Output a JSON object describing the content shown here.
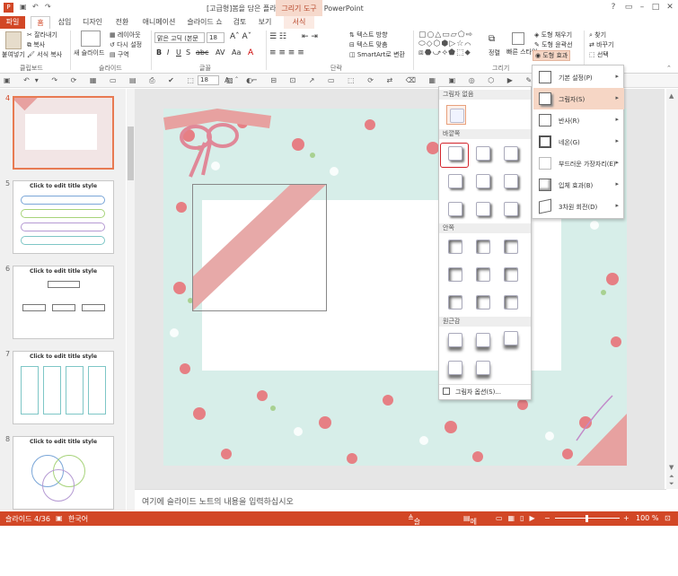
{
  "titlebar": {
    "title": "[고급형]봄을 담은 플라워 카드.pptx - PowerPoint",
    "context_tab_label": "그리기 도구"
  },
  "tabs": [
    "파일",
    "홈",
    "삽입",
    "디자인",
    "전환",
    "애니메이션",
    "슬라이드 쇼",
    "검토",
    "보기",
    "서식"
  ],
  "ribbon": {
    "clipboard": {
      "paste": "붙여넣기",
      "cut": "잘라내기",
      "copy": "복사",
      "format_copy": "서식 복사",
      "group": "클립보드"
    },
    "slides": {
      "new_slide": "새 슬라이드",
      "layout": "레이아웃",
      "reset": "다시 설정",
      "section": "구역",
      "group": "슬라이드"
    },
    "font": {
      "name": "맑은 고딕 (본문",
      "size": "18",
      "group": "글꼴"
    },
    "paragraph": {
      "text_dir": "텍스트 방향",
      "align_text": "텍스트 맞춤",
      "smartart": "SmartArt로 변환",
      "group": "단락"
    },
    "drawing": {
      "arrange": "정렬",
      "quick_styles": "빠른 스타일",
      "fill": "도형 채우기",
      "outline": "도형 윤곽선",
      "effects": "도형 효과",
      "group": "그리기"
    },
    "editing": {
      "find": "찾기",
      "replace": "바꾸기",
      "select": "선택"
    }
  },
  "qat": {
    "font_size": "18"
  },
  "thumbnails": [
    {
      "num": "4",
      "title": ""
    },
    {
      "num": "5",
      "title": "Click to edit title style"
    },
    {
      "num": "6",
      "title": "Click to edit title style"
    },
    {
      "num": "7",
      "title": "Click to edit title style"
    },
    {
      "num": "8",
      "title": "Click to edit title style"
    }
  ],
  "gallery": {
    "none_header": "그림자 없음",
    "outer_header": "바깥쪽",
    "inner_header": "안쪽",
    "persp_header": "원근감",
    "options": "그림자 옵션(S)..."
  },
  "submenu": [
    {
      "label": "기본 설정(P)",
      "hot": false
    },
    {
      "label": "그림자(S)",
      "hot": true
    },
    {
      "label": "반사(R)",
      "hot": false
    },
    {
      "label": "네온(G)",
      "hot": false
    },
    {
      "label": "부드러운 가장자리(E)",
      "hot": false
    },
    {
      "label": "입체 효과(B)",
      "hot": false
    },
    {
      "label": "3차원 회전(D)",
      "hot": false
    }
  ],
  "notes": {
    "placeholder": "여기에 슬라이드 노트의 내용을 입력하십시오"
  },
  "status": {
    "slide": "슬라이드 4/36",
    "lang": "한국어",
    "notes": "슬라이드 노트",
    "comments": "메모",
    "zoom": "100 %"
  },
  "colors": {
    "accent": "#d24726",
    "slide_bg": "#d7eee9",
    "ribbon_pink": "#e7a1a0"
  }
}
